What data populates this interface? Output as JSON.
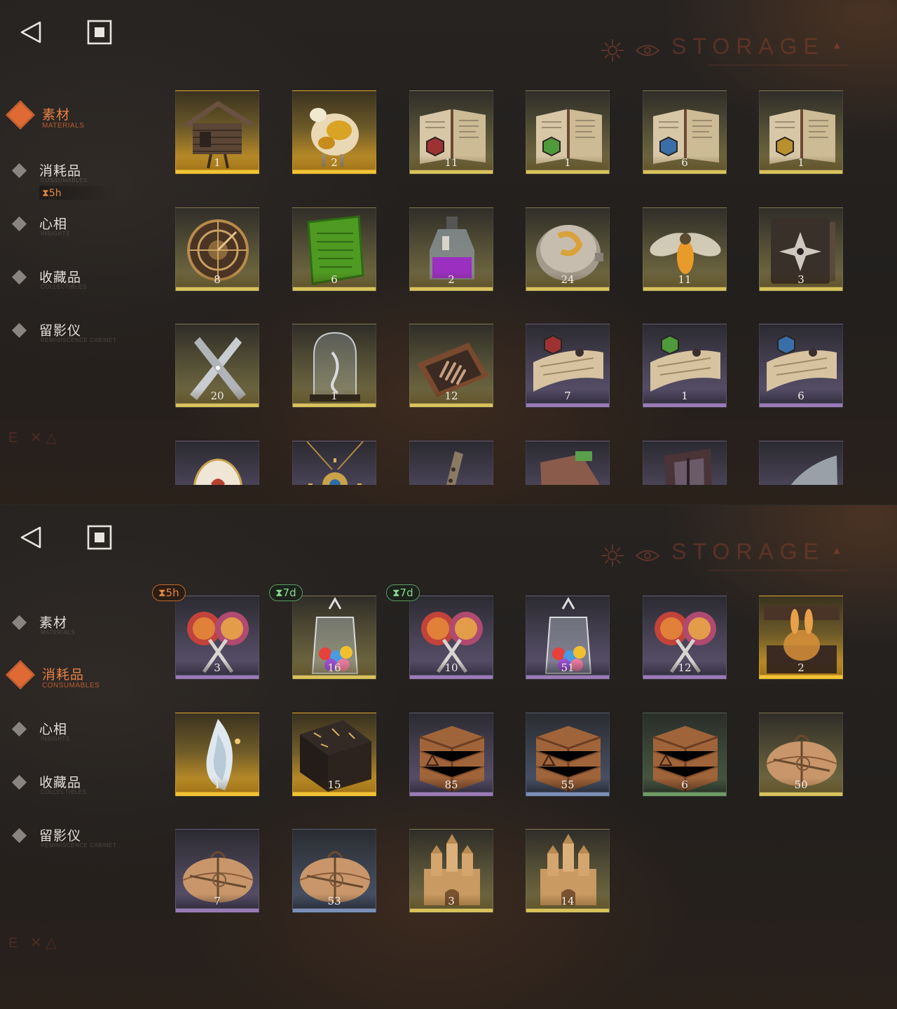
{
  "panels": [
    {
      "storage_title": "STORAGE",
      "nav": [
        {
          "label": "素材",
          "sub": "MATERIALS",
          "active": true
        },
        {
          "label": "消耗品",
          "sub": "CONSUMABLES",
          "active": false
        },
        {
          "label": "心相",
          "sub": "INSIGHTS",
          "active": false
        },
        {
          "label": "收藏品",
          "sub": "COLLECTIBLES",
          "active": false
        },
        {
          "label": "留影仪",
          "sub": "REMINISCENCE CABINET",
          "active": false
        }
      ],
      "timer": "⧗5h",
      "footer": "E ✕△",
      "items": [
        {
          "icon": "chicken-leg-hut",
          "count": "1",
          "rarity": "gold"
        },
        {
          "icon": "gilded-sheep",
          "count": "2",
          "rarity": "gold"
        },
        {
          "icon": "book-red-sigil",
          "count": "11",
          "rarity": "yellow"
        },
        {
          "icon": "book-green-sigil",
          "count": "1",
          "rarity": "yellow"
        },
        {
          "icon": "book-blue-sigil",
          "count": "6",
          "rarity": "yellow"
        },
        {
          "icon": "book-gold-sigil",
          "count": "1",
          "rarity": "yellow"
        },
        {
          "icon": "astrolabe",
          "count": "8",
          "rarity": "yellow"
        },
        {
          "icon": "green-tablet",
          "count": "6",
          "rarity": "yellow"
        },
        {
          "icon": "purple-bottle",
          "count": "2",
          "rarity": "yellow"
        },
        {
          "icon": "engraved-medallion",
          "count": "24",
          "rarity": "yellow"
        },
        {
          "icon": "firefly",
          "count": "11",
          "rarity": "yellow"
        },
        {
          "icon": "dark-tome",
          "count": "3",
          "rarity": "yellow"
        },
        {
          "icon": "crossed-blades",
          "count": "20",
          "rarity": "yellow"
        },
        {
          "icon": "glass-bell-jar",
          "count": "1",
          "rarity": "yellow"
        },
        {
          "icon": "hand-in-box",
          "count": "12",
          "rarity": "yellow"
        },
        {
          "icon": "scroll-red-sigil",
          "count": "7",
          "rarity": "purple"
        },
        {
          "icon": "scroll-green-sigil",
          "count": "1",
          "rarity": "purple"
        },
        {
          "icon": "scroll-blue-sigil",
          "count": "6",
          "rarity": "purple"
        },
        {
          "icon": "ornate-egg",
          "count": "",
          "rarity": "purple"
        },
        {
          "icon": "golden-pendant",
          "count": "",
          "rarity": "purple"
        },
        {
          "icon": "bone-flute",
          "count": "",
          "rarity": "purple"
        },
        {
          "icon": "stone-fragment",
          "count": "",
          "rarity": "purple"
        },
        {
          "icon": "window-frame",
          "count": "",
          "rarity": "purple"
        },
        {
          "icon": "brass-gadget",
          "count": "",
          "rarity": "purple"
        }
      ]
    },
    {
      "storage_title": "STORAGE",
      "nav": [
        {
          "label": "素材",
          "sub": "MATERIALS",
          "active": false
        },
        {
          "label": "消耗品",
          "sub": "CONSUMABLES",
          "active": true
        },
        {
          "label": "心相",
          "sub": "INSIGHTS",
          "active": false
        },
        {
          "label": "收藏品",
          "sub": "COLLECTIBLES",
          "active": false
        },
        {
          "label": "留影仪",
          "sub": "REMINISCENCE CABINET",
          "active": false
        }
      ],
      "footer": "E ✕△",
      "items": [
        {
          "icon": "lollipops",
          "count": "3",
          "rarity": "purple",
          "badge": "⧗5h",
          "badge_color": "orange"
        },
        {
          "icon": "candy-jar",
          "count": "16",
          "rarity": "yellow",
          "badge": "⧗7d",
          "badge_color": "green"
        },
        {
          "icon": "lollipops",
          "count": "10",
          "rarity": "purple",
          "badge": "⧗7d",
          "badge_color": "green"
        },
        {
          "icon": "candy-jar",
          "count": "51",
          "rarity": "purple"
        },
        {
          "icon": "lollipops",
          "count": "12",
          "rarity": "purple"
        },
        {
          "icon": "rabbit-chest",
          "count": "2",
          "rarity": "gold"
        },
        {
          "icon": "crystal-flame",
          "count": "1",
          "rarity": "gold"
        },
        {
          "icon": "rune-box",
          "count": "15",
          "rarity": "gold"
        },
        {
          "icon": "wooden-crate",
          "count": "85",
          "rarity": "purple"
        },
        {
          "icon": "wooden-crate",
          "count": "55",
          "rarity": "blue"
        },
        {
          "icon": "wooden-crate",
          "count": "6",
          "rarity": "green"
        },
        {
          "icon": "parcel",
          "count": "50",
          "rarity": "yellow"
        },
        {
          "icon": "parcel",
          "count": "7",
          "rarity": "purple"
        },
        {
          "icon": "parcel",
          "count": "53",
          "rarity": "blue"
        },
        {
          "icon": "castle",
          "count": "3",
          "rarity": "yellow"
        },
        {
          "icon": "castle",
          "count": "14",
          "rarity": "yellow"
        }
      ]
    }
  ]
}
